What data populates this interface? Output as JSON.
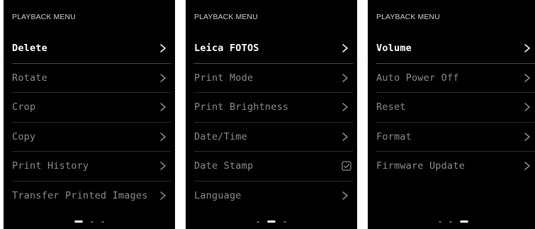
{
  "screens": [
    {
      "header": "PLAYBACK MENU",
      "items": [
        {
          "label": "Delete",
          "control": "chevron",
          "active": true
        },
        {
          "label": "Rotate",
          "control": "chevron",
          "active": false
        },
        {
          "label": "Crop",
          "control": "chevron",
          "active": false
        },
        {
          "label": "Copy",
          "control": "chevron",
          "active": false
        },
        {
          "label": "Print History",
          "control": "chevron",
          "active": false
        },
        {
          "label": "Transfer Printed Images",
          "control": "chevron",
          "active": false
        }
      ],
      "page_indicator": {
        "pages": 3,
        "current": 1
      }
    },
    {
      "header": "PLAYBACK MENU",
      "items": [
        {
          "label": "Leica FOTOS",
          "control": "chevron",
          "active": true
        },
        {
          "label": "Print Mode",
          "control": "chevron",
          "active": false
        },
        {
          "label": "Print Brightness",
          "control": "chevron",
          "active": false
        },
        {
          "label": "Date/Time",
          "control": "chevron",
          "active": false
        },
        {
          "label": "Date Stamp",
          "control": "checkbox-checked",
          "active": false
        },
        {
          "label": "Language",
          "control": "chevron",
          "active": false
        }
      ],
      "page_indicator": {
        "pages": 3,
        "current": 2
      }
    },
    {
      "header": "PLAYBACK MENU",
      "items": [
        {
          "label": "Volume",
          "control": "chevron",
          "active": true
        },
        {
          "label": "Auto Power Off",
          "control": "chevron",
          "active": false
        },
        {
          "label": "Reset",
          "control": "chevron",
          "active": false
        },
        {
          "label": "Format",
          "control": "chevron",
          "active": false
        },
        {
          "label": "Firmware Update",
          "control": "chevron",
          "active": false
        }
      ],
      "page_indicator": {
        "pages": 3,
        "current": 3
      }
    }
  ],
  "colors": {
    "background": "#000000",
    "accent_underline": "#c5131b",
    "active_text": "#ffffff",
    "inactive_text": "#8c8c8c"
  }
}
